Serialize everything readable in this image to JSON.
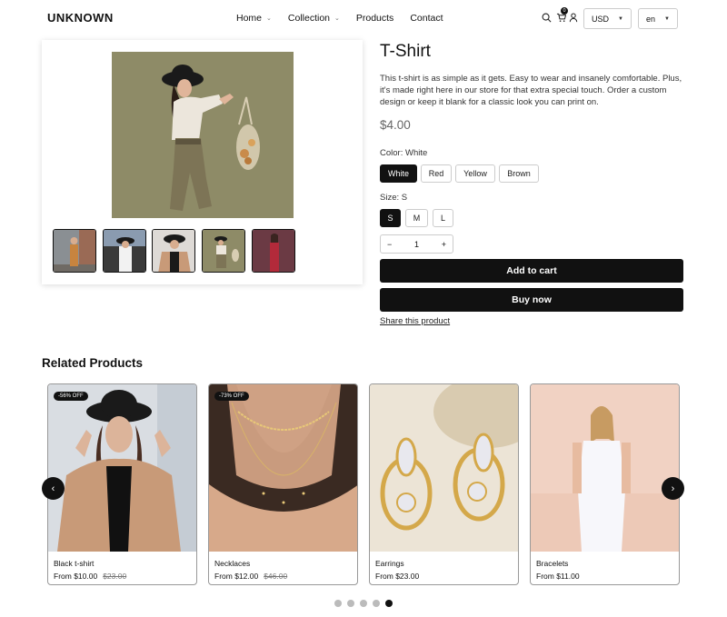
{
  "header": {
    "logo": "UNKNOWN",
    "nav": [
      {
        "label": "Home",
        "has_dropdown": true
      },
      {
        "label": "Collection",
        "has_dropdown": true
      },
      {
        "label": "Products",
        "has_dropdown": false
      },
      {
        "label": "Contact",
        "has_dropdown": false
      }
    ],
    "cart_count": "0",
    "currency": "USD",
    "language": "en",
    "icons": [
      "search-icon",
      "cart-icon",
      "user-icon"
    ]
  },
  "product": {
    "title": "T-Shirt",
    "description": "This t-shirt is as simple as it gets. Easy to wear and insanely comfortable. Plus, it's made right here in our store for that extra special touch. Order a custom design or keep it blank for a classic look you can print on.",
    "price": "$4.00",
    "color_label": "Color: White",
    "colors": [
      "White",
      "Red",
      "Yellow",
      "Brown"
    ],
    "selected_color": "White",
    "size_label": "Size: S",
    "sizes": [
      "S",
      "M",
      "L"
    ],
    "selected_size": "S",
    "quantity": "1",
    "qty_minus": "−",
    "qty_plus": "+",
    "add_to_cart": "Add to cart",
    "buy_now": "Buy now",
    "share": "Share this product"
  },
  "related": {
    "title": "Related Products",
    "items": [
      {
        "name": "Black t-shirt",
        "price": "From $10.00",
        "old_price": "$23.00",
        "badge": "-56% OFF"
      },
      {
        "name": "Necklaces",
        "price": "From $12.00",
        "old_price": "$46.00",
        "badge": "-73% OFF"
      },
      {
        "name": "Earrings",
        "price": "From $23.00",
        "old_price": "",
        "badge": ""
      },
      {
        "name": "Bracelets",
        "price": "From $11.00",
        "old_price": "",
        "badge": ""
      }
    ],
    "prev_arrow": "‹",
    "next_arrow": "›",
    "dots_count": 5,
    "active_dot": 4
  },
  "colors": {
    "accent": "#111111",
    "price_gray": "#666666"
  }
}
